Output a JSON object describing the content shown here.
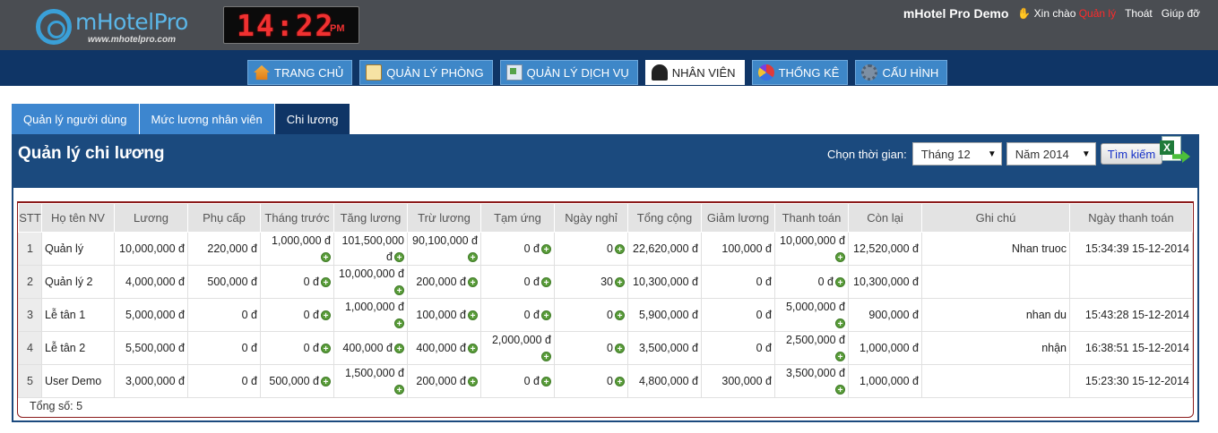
{
  "header": {
    "logo_text": "mHotelPro",
    "logo_sub": "www.mhotelpro.com",
    "clock_time": "14:22",
    "clock_ampm": "PM",
    "app_title": "mHotel Pro Demo",
    "greeting": "Xin chào",
    "user_name": "Quản lý",
    "logout": "Thoát",
    "help": "Giúp đỡ"
  },
  "nav": [
    {
      "label": "Trang chủ",
      "icon": "home-icon"
    },
    {
      "label": "Quản lý phòng",
      "icon": "book-icon"
    },
    {
      "label": "Quản lý dịch vụ",
      "icon": "service-icon"
    },
    {
      "label": "Nhân viên",
      "icon": "user-icon",
      "active": true
    },
    {
      "label": "Thống kê",
      "icon": "pie-chart-icon"
    },
    {
      "label": "Cấu hình",
      "icon": "gear-icon"
    }
  ],
  "tabs": [
    {
      "label": "Quản lý người dùng"
    },
    {
      "label": "Mức lương nhân viên"
    },
    {
      "label": "Chi lương",
      "active": true
    }
  ],
  "panel": {
    "title": "Quản lý chi lương",
    "filter_label": "Chọn thời gian:",
    "month": "Tháng 12",
    "year": "Năm 2014",
    "search_button": "Tìm kiếm"
  },
  "table": {
    "columns": [
      "STT",
      "Họ tên NV",
      "Lương",
      "Phụ cấp",
      "Tháng trước",
      "Tăng lương",
      "Trừ lương",
      "Tạm ứng",
      "Ngày nghỉ",
      "Tổng cộng",
      "Giảm lương",
      "Thanh toán",
      "Còn lại",
      "Ghi chú",
      "Ngày thanh toán"
    ],
    "rows": [
      {
        "stt": "1",
        "name": "Quản lý",
        "luong": "10,000,000 đ",
        "phucap": "220,000 đ",
        "thangtruoc": "1,000,000 đ",
        "tangluong": "101,500,000 đ",
        "truluong": "90,100,000 đ",
        "tamung": "0 đ",
        "ngaynghi": "0",
        "tongcong": "22,620,000 đ",
        "giamluong": "100,000 đ",
        "thanhtoan": "10,000,000 đ",
        "conlai": "12,520,000 đ",
        "ghichu": "Nhan truoc",
        "ngaytt": "15:34:39 15-12-2014"
      },
      {
        "stt": "2",
        "name": "Quản lý 2",
        "luong": "4,000,000 đ",
        "phucap": "500,000 đ",
        "thangtruoc": "0 đ",
        "tangluong": "10,000,000 đ",
        "truluong": "200,000 đ",
        "tamung": "0 đ",
        "ngaynghi": "30",
        "tongcong": "10,300,000 đ",
        "giamluong": "0 đ",
        "thanhtoan": "0 đ",
        "conlai": "10,300,000 đ",
        "ghichu": "",
        "ngaytt": ""
      },
      {
        "stt": "3",
        "name": "Lễ tân 1",
        "luong": "5,000,000 đ",
        "phucap": "0 đ",
        "thangtruoc": "0 đ",
        "tangluong": "1,000,000 đ",
        "truluong": "100,000 đ",
        "tamung": "0 đ",
        "ngaynghi": "0",
        "tongcong": "5,900,000 đ",
        "giamluong": "0 đ",
        "thanhtoan": "5,000,000 đ",
        "conlai": "900,000 đ",
        "ghichu": "nhan du",
        "ngaytt": "15:43:28 15-12-2014"
      },
      {
        "stt": "4",
        "name": "Lễ tân 2",
        "luong": "5,500,000 đ",
        "phucap": "0 đ",
        "thangtruoc": "0 đ",
        "tangluong": "400,000 đ",
        "truluong": "400,000 đ",
        "tamung": "2,000,000 đ",
        "ngaynghi": "0",
        "tongcong": "3,500,000 đ",
        "giamluong": "0 đ",
        "thanhtoan": "2,500,000 đ",
        "conlai": "1,000,000 đ",
        "ghichu": "nhận",
        "ngaytt": "16:38:51 15-12-2014"
      },
      {
        "stt": "5",
        "name": "User Demo",
        "luong": "3,000,000 đ",
        "phucap": "0 đ",
        "thangtruoc": "500,000 đ",
        "tangluong": "1,500,000 đ",
        "truluong": "200,000 đ",
        "tamung": "0 đ",
        "ngaynghi": "0",
        "tongcong": "4,800,000 đ",
        "giamluong": "300,000 đ",
        "thanhtoan": "3,500,000 đ",
        "conlai": "1,000,000 đ",
        "ghichu": "",
        "ngaytt": "15:23:30 15-12-2014"
      }
    ],
    "total_label": "Tổng số: 5"
  },
  "colors": {
    "topbar": "#4a4d52",
    "navbar": "#0f3566",
    "nav_button": "#3e87c8",
    "panel_header": "#1b4a7e",
    "user_name": "#ff2a2a"
  }
}
